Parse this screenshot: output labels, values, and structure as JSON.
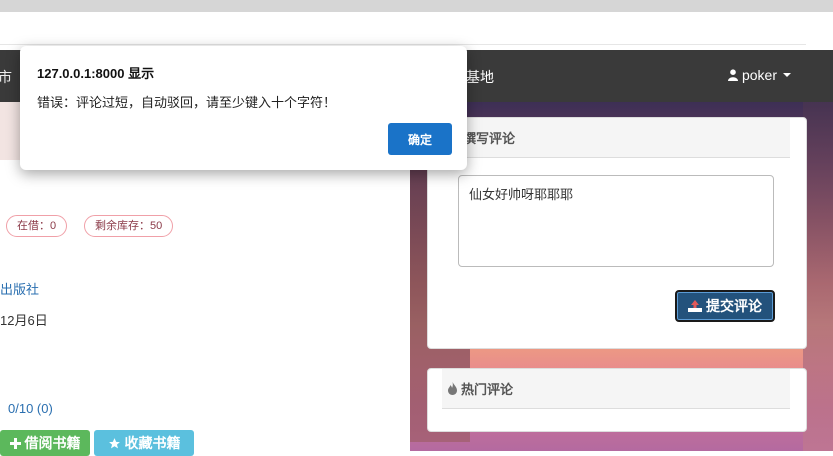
{
  "navbar": {
    "left_fragment": "市",
    "mid_fragment": "宽基地",
    "user_name": "poker"
  },
  "book": {
    "badges": [
      {
        "label": "在借：0"
      },
      {
        "label": "剩余库存：50"
      }
    ],
    "publisher_fragment": "出版社",
    "date_fragment": "12月6日",
    "rating_fragment": "0/10 (0)",
    "borrow_label": "借阅书籍",
    "favorite_label": "收藏书籍"
  },
  "write_comment": {
    "header": "撰写评论",
    "textarea_value": "仙女好帅呀耶耶耶",
    "submit_label": "提交评论"
  },
  "hot_comments": {
    "header": "热门评论"
  },
  "dialog": {
    "title": "127.0.0.1:8000 显示",
    "message": "错误：评论过短，自动驳回，请至少键入十个字符！",
    "ok_label": "确定"
  },
  "colors": {
    "navbar": "#3a3a3a",
    "borrow": "#5cb85c",
    "favorite": "#5bc0de",
    "submit": "#23527c",
    "dialog_ok": "#1a73c8",
    "badge_border": "#f0a0a8"
  }
}
